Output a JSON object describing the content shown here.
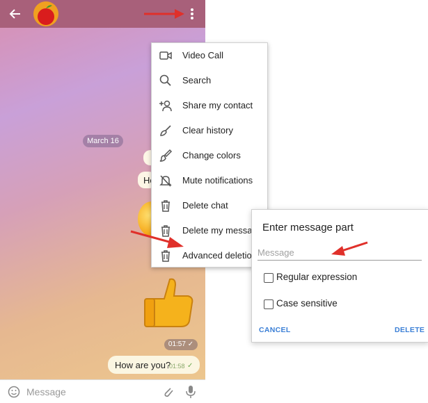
{
  "chat": {
    "date_separator": "March 16",
    "sticker_time": "01:57",
    "message_text": "How are you?",
    "message_time": "01:58",
    "input_placeholder": "Message"
  },
  "menu": {
    "items": [
      {
        "label": "Video Call",
        "icon": "video-call-icon"
      },
      {
        "label": "Search",
        "icon": "search-icon"
      },
      {
        "label": "Share my contact",
        "icon": "share-contact-icon"
      },
      {
        "label": "Clear history",
        "icon": "broom-icon"
      },
      {
        "label": "Change colors",
        "icon": "paint-brush-icon"
      },
      {
        "label": "Mute notifications",
        "icon": "bell-muted-icon"
      },
      {
        "label": "Delete chat",
        "icon": "trash-icon"
      },
      {
        "label": "Delete my messages",
        "icon": "trash-icon"
      },
      {
        "label": "Advanced deletion",
        "icon": "trash-icon"
      }
    ]
  },
  "dialog": {
    "title": "Enter message part",
    "input_placeholder": "Message",
    "options": [
      "Regular expression",
      "Case sensitive"
    ],
    "cancel_label": "CANCEL",
    "delete_label": "DELETE"
  },
  "colors": {
    "header": "#a8607a",
    "accent": "#3b7fd6",
    "annotation_arrow": "#e0302a"
  }
}
